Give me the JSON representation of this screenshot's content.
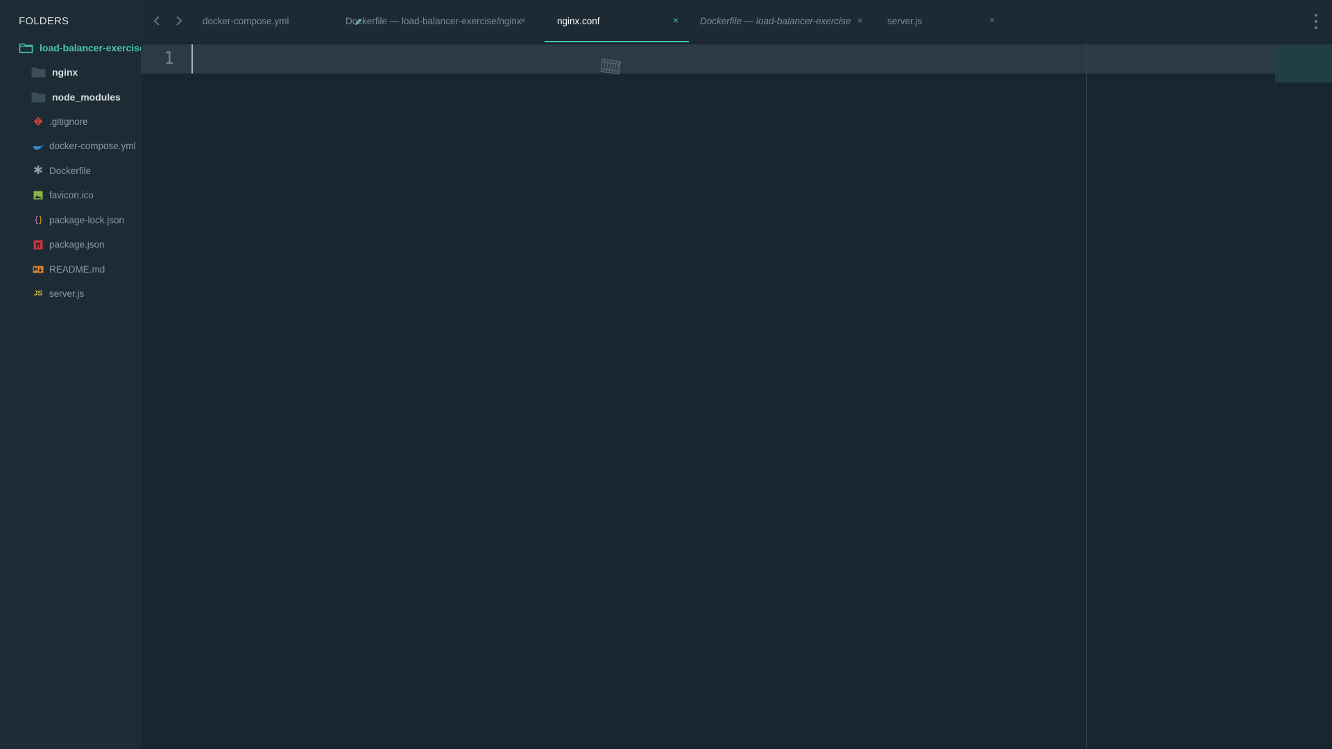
{
  "sidebar": {
    "title": "FOLDERS",
    "root": {
      "label": "load-balancer-exercise",
      "icon": "folder-open-icon"
    },
    "folders": [
      {
        "label": "nginx",
        "icon": "folder-icon"
      },
      {
        "label": "node_modules",
        "icon": "folder-icon"
      }
    ],
    "files": [
      {
        "label": ".gitignore",
        "icon": "git-icon",
        "color": "#d0413b"
      },
      {
        "label": "docker-compose.yml",
        "icon": "docker-icon",
        "color": "#2f8fd0"
      },
      {
        "label": "Dockerfile",
        "icon": "asterisk-icon",
        "color": "#8b9aa4"
      },
      {
        "label": "favicon.ico",
        "icon": "image-icon",
        "color": "#8bb44c"
      },
      {
        "label": "package-lock.json",
        "icon": "braces-icon",
        "color": "#c9a227"
      },
      {
        "label": "package.json",
        "icon": "npm-icon",
        "color": "#c6353a"
      },
      {
        "label": "README.md",
        "icon": "markdown-icon",
        "color": "#e0812f"
      },
      {
        "label": "server.js",
        "icon": "js-icon",
        "color": "#e9c349"
      }
    ]
  },
  "tabs": [
    {
      "label": "docker-compose.yml",
      "state": "modified"
    },
    {
      "label": "Dockerfile — load-balancer-exercise/nginx",
      "state": "normal",
      "close": "×"
    },
    {
      "label": "nginx.conf",
      "state": "active",
      "close": "×"
    },
    {
      "label": "Dockerfile — load-balancer-exercise",
      "state": "preview",
      "close": "×"
    },
    {
      "label": "server.js",
      "state": "normal",
      "close": "×"
    }
  ],
  "editor": {
    "line_numbers": [
      "1"
    ]
  },
  "colors": {
    "accent": "#4ac5b6",
    "sidebar_bg": "#1d2b34",
    "editor_bg": "#17262f"
  }
}
